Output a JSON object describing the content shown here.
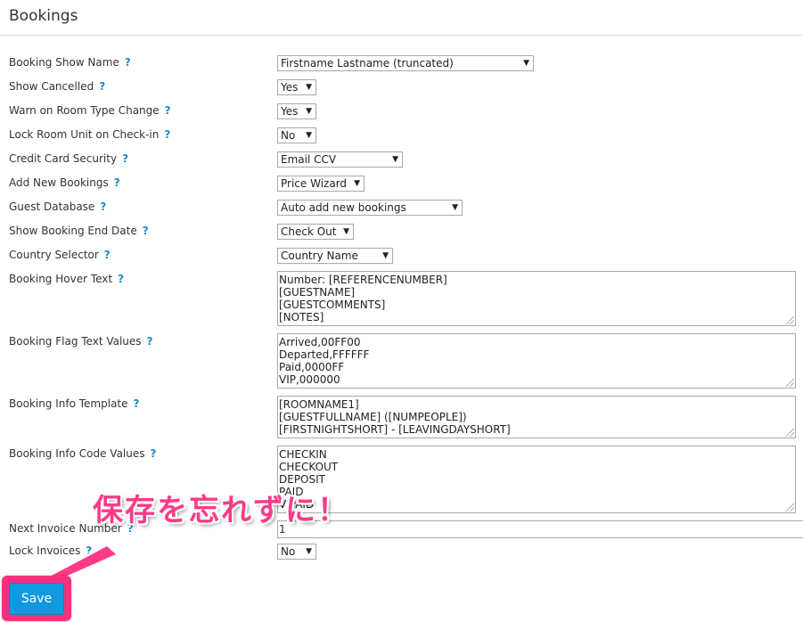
{
  "header": {
    "title": "Bookings"
  },
  "help_symbol": "?",
  "fields": {
    "booking_show_name": {
      "label": "Booking Show Name",
      "value": "Firstname Lastname (truncated)"
    },
    "show_cancelled": {
      "label": "Show Cancelled",
      "value": "Yes"
    },
    "warn_room_type": {
      "label": "Warn on Room Type Change",
      "value": "Yes"
    },
    "lock_room_unit": {
      "label": "Lock Room Unit on Check-in",
      "value": "No"
    },
    "credit_card_security": {
      "label": "Credit Card Security",
      "value": "Email CCV"
    },
    "add_new_bookings": {
      "label": "Add New Bookings",
      "value": "Price Wizard"
    },
    "guest_database": {
      "label": "Guest Database",
      "value": "Auto add new bookings"
    },
    "show_booking_end_date": {
      "label": "Show Booking End Date",
      "value": "Check Out"
    },
    "country_selector": {
      "label": "Country Selector",
      "value": "Country Name"
    },
    "booking_hover_text": {
      "label": "Booking Hover Text",
      "lines": [
        "Number: [REFERENCENUMBER]",
        "[GUESTNAME]",
        "[GUESTCOMMENTS]",
        "[NOTES]"
      ]
    },
    "booking_flag_text_values": {
      "label": "Booking Flag Text Values",
      "lines": [
        "Arrived,00FF00",
        "Departed,FFFFFF",
        "Paid,0000FF",
        "VIP,000000"
      ]
    },
    "booking_info_template": {
      "label": "Booking Info Template",
      "lines": [
        "[ROOMNAME1]",
        "[GUESTFULLNAME] ([NUMPEOPLE])",
        "[FIRSTNIGHTSHORT] - [LEAVINGDAYSHORT]"
      ]
    },
    "booking_info_code_values": {
      "label": "Booking Info Code Values",
      "lines": [
        "CHECKIN",
        "CHECKOUT",
        "DEPOSIT",
        "PAID",
        "VIPAID"
      ]
    },
    "next_invoice_number": {
      "label": "Next Invoice Number",
      "value": "1"
    },
    "lock_invoices": {
      "label": "Lock Invoices",
      "value": "No"
    }
  },
  "save_label": "Save",
  "callout": {
    "text": "保存を忘れずに！",
    "color": "#ff3a86"
  },
  "colors": {
    "help": "#1a8bd2",
    "save_button": "#0f9ae0",
    "highlight": "#ff2f7e"
  }
}
